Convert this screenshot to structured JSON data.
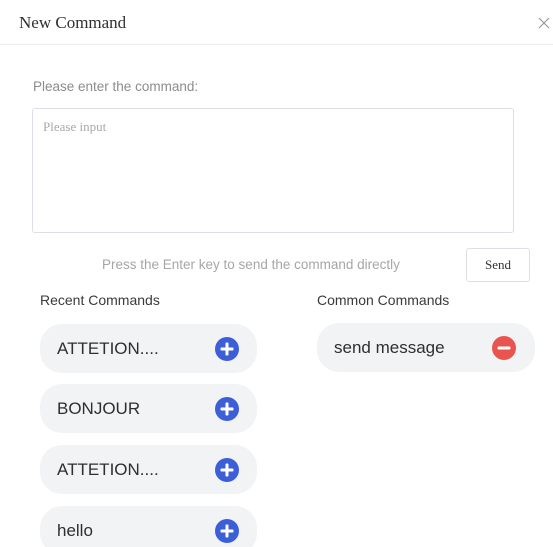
{
  "dialog": {
    "title": "New Command",
    "close_icon": "close-icon"
  },
  "input": {
    "label": "Please enter the command:",
    "placeholder": "Please input",
    "value": ""
  },
  "hint": "Press the Enter key to send the command directly",
  "send_label": "Send",
  "recent": {
    "title": "Recent Commands",
    "items": [
      {
        "label": "ATTETION....",
        "icon": "add-circle-icon"
      },
      {
        "label": "BONJOUR",
        "icon": "add-circle-icon"
      },
      {
        "label": "ATTETION....",
        "icon": "add-circle-icon"
      },
      {
        "label": "hello",
        "icon": "add-circle-icon"
      }
    ]
  },
  "common": {
    "title": "Common Commands",
    "items": [
      {
        "label": "send message",
        "icon": "remove-circle-icon"
      }
    ]
  },
  "colors": {
    "add_icon": "#3c5fd8",
    "remove_icon": "#e8554e",
    "chip_background": "#f2f3f5"
  }
}
